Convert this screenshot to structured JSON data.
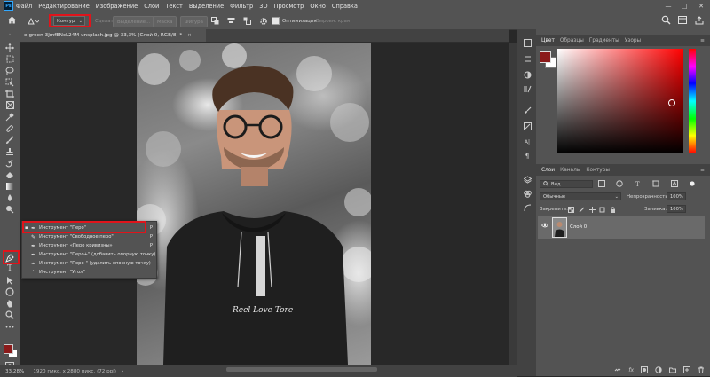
{
  "app": {
    "logo_text": "Ps",
    "menu": [
      "Файл",
      "Редактирование",
      "Изображение",
      "Слои",
      "Текст",
      "Выделение",
      "Фильтр",
      "3D",
      "Просмотр",
      "Окно",
      "Справка"
    ]
  },
  "window_controls": {
    "minimize": "—",
    "maximize": "□",
    "close": "✕"
  },
  "options_bar": {
    "mode_value": "Контур",
    "make_label": "Сделать:",
    "selection_btn": "Выделение...",
    "mask_btn": "Маска",
    "shape_btn": "Фигура",
    "optimization_label": "Оптимизация",
    "align_edges_label": "Выровн. края"
  },
  "document": {
    "tab_title": "e-green-3JmfENcL24M-unsplash.jpg @ 33,3% (Слой 0, RGB/8) *",
    "tab_close": "×"
  },
  "status": {
    "zoom": "33,28%",
    "doc_info": "1920 пикс. x 2880 пикс. (72 ppi)",
    "arrow": "›"
  },
  "shirt_text": "Reel Love Tore",
  "pen_popup": {
    "items": [
      {
        "label": "Инструмент \"Перо\"",
        "shortcut": "P",
        "selected": true
      },
      {
        "label": "Инструмент \"Свободное перо\"",
        "shortcut": "P"
      },
      {
        "label": "Инструмент «Перо кривизны»",
        "shortcut": "P"
      },
      {
        "label": "Инструмент \"Перо+\" (добавить опорную точку)",
        "shortcut": ""
      },
      {
        "label": "Инструмент \"Перо-\" (удалить опорную точку)",
        "shortcut": ""
      },
      {
        "label": "Инструмент \"Угол\"",
        "shortcut": ""
      }
    ]
  },
  "color_panel": {
    "tabs": [
      "Цвет",
      "Образцы",
      "Градиенты",
      "Узоры"
    ],
    "foreground": "#8b1a1a",
    "background": "#ffffff",
    "menu_icon": "≡"
  },
  "layers_panel": {
    "tabs": [
      "Слои",
      "Каналы",
      "Контуры"
    ],
    "filter_value": "Вид",
    "blend_mode": "Обычные",
    "opacity_label": "Непрозрачность:",
    "opacity_value": "100%",
    "lock_label": "Закрепить:",
    "fill_label": "Заливка:",
    "fill_value": "100%",
    "layers": [
      {
        "name": "Слой 0",
        "visible": true
      }
    ]
  },
  "colors": {
    "accent_red": "#e0141b",
    "panel_bg": "#535353",
    "dark_bg": "#282828"
  }
}
